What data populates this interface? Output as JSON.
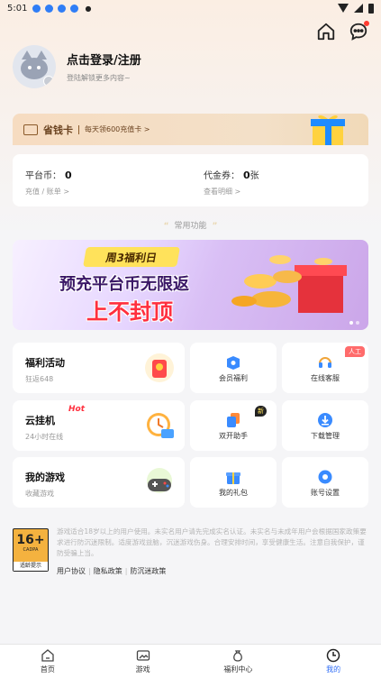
{
  "status_bar": {
    "time": "5:01"
  },
  "profile": {
    "title": "点击登录/注册",
    "subtitle": "登陆解锁更多内容~"
  },
  "vip_card": {
    "name": "省钱卡",
    "promo": "每天领600充值卡 >"
  },
  "balance": {
    "platform_coin_label": "平台币：",
    "platform_coin_value": "0",
    "platform_coin_link": "充值 / 账单 >",
    "voucher_label": "代金券：",
    "voucher_value": "0",
    "voucher_unit": "张",
    "voucher_link": "查看明细 >"
  },
  "section_title": "常用功能",
  "banner": {
    "tag": "周3福利日",
    "line1": "预充平台币无限返",
    "line2": "上不封顶"
  },
  "tiles": {
    "welfare": {
      "title": "福利活动",
      "sub": "狂返648"
    },
    "cloud": {
      "title": "云挂机",
      "sub": "24小时在线",
      "badge": "Hot"
    },
    "mygames": {
      "title": "我的游戏",
      "sub": "收藏游戏"
    },
    "member": {
      "label": "会员福利"
    },
    "service": {
      "label": "在线客服",
      "badge": "人工"
    },
    "dual": {
      "label": "双开助手",
      "badge": "新"
    },
    "download": {
      "label": "下载管理"
    },
    "gifts": {
      "label": "我的礼包"
    },
    "settings": {
      "label": "账号设置"
    }
  },
  "notice": {
    "age": "16+",
    "age_org": "CADPA",
    "age_tip": "适龄提示",
    "text": "游戏适合18岁以上的用户使用。未实名用户请先完成实名认证。未实名与未成年用户会根据国家政策要求进行防沉迷限制。适度游戏益脑，沉迷游戏伤身。合理安排时间，享受健康生活。注意自我保护，谨防受骗上当。",
    "link1": "用户协议",
    "link2": "隐私政策",
    "link3": "防沉迷政策"
  },
  "tabbar": {
    "home": "首页",
    "games": "游戏",
    "welfare": "福利中心",
    "mine": "我的"
  },
  "colors": {
    "accent": "#2f6df6",
    "vip_gold": "#6b4320",
    "hot_red": "#ff2f3e"
  }
}
